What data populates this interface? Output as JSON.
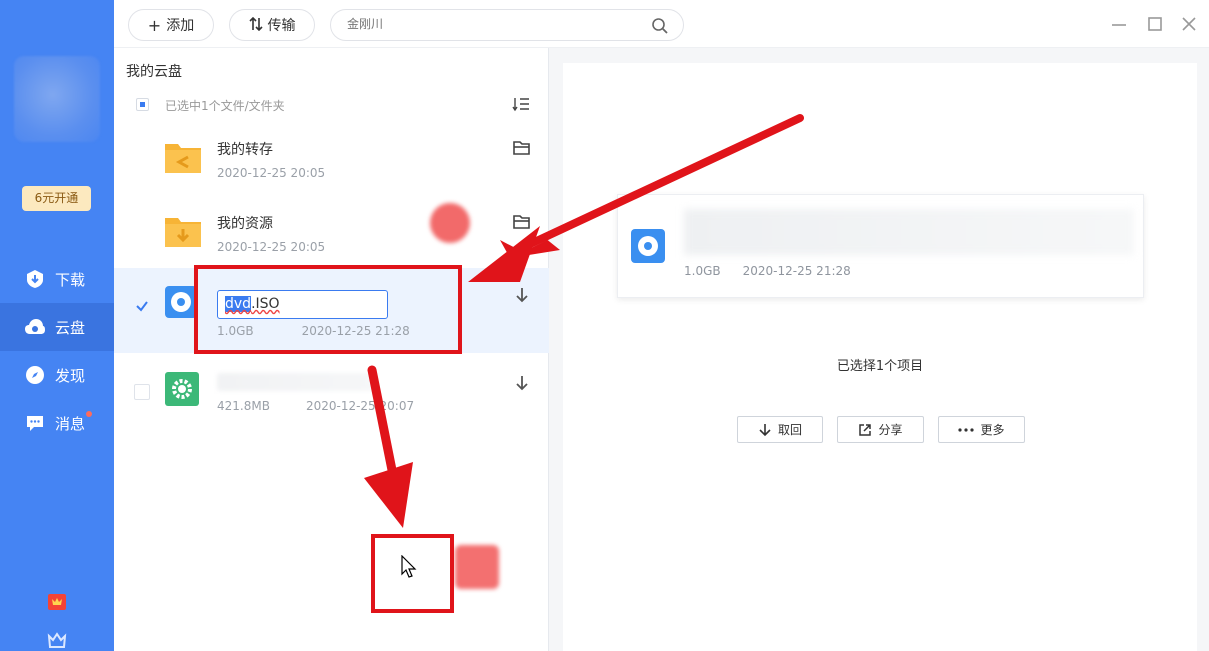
{
  "sidebar": {
    "vip_label": "6元开通",
    "nav": [
      {
        "label": "下载",
        "icon": "download-shield-icon",
        "active": false
      },
      {
        "label": "云盘",
        "icon": "cloud-icon",
        "active": true
      },
      {
        "label": "发现",
        "icon": "compass-icon",
        "active": false
      },
      {
        "label": "消息",
        "icon": "message-icon",
        "active": false,
        "has_dot": true
      }
    ]
  },
  "toolbar": {
    "add_label": "添加",
    "transfer_label": "传输",
    "search_placeholder": "金刚川"
  },
  "list": {
    "title": "我的云盘",
    "selection_text": "已选中1个文件/文件夹",
    "items": [
      {
        "name": "我的转存",
        "size": "",
        "date": "2020-12-25 20:05",
        "type": "folder-transfer"
      },
      {
        "name": "我的资源",
        "size": "",
        "date": "2020-12-25 20:05",
        "type": "folder-resource"
      },
      {
        "rename_selected": "dvd",
        "rename_rest": ".ISO",
        "size": "1.0GB",
        "date": "2020-12-25 21:28",
        "type": "disc",
        "selected": true
      },
      {
        "name": "",
        "size": "421.8MB",
        "date": "2020-12-25 20:07",
        "type": "app"
      }
    ]
  },
  "detail": {
    "card_size": "1.0GB",
    "card_date": "2020-12-25 21:28",
    "selected_count": "已选择1个项目",
    "buttons": {
      "cancel": "取回",
      "share": "分享",
      "more": "更多"
    }
  },
  "colors": {
    "sidebar": "#4584f3",
    "accent": "#3a7bf0",
    "annotation": "#e0141a"
  }
}
